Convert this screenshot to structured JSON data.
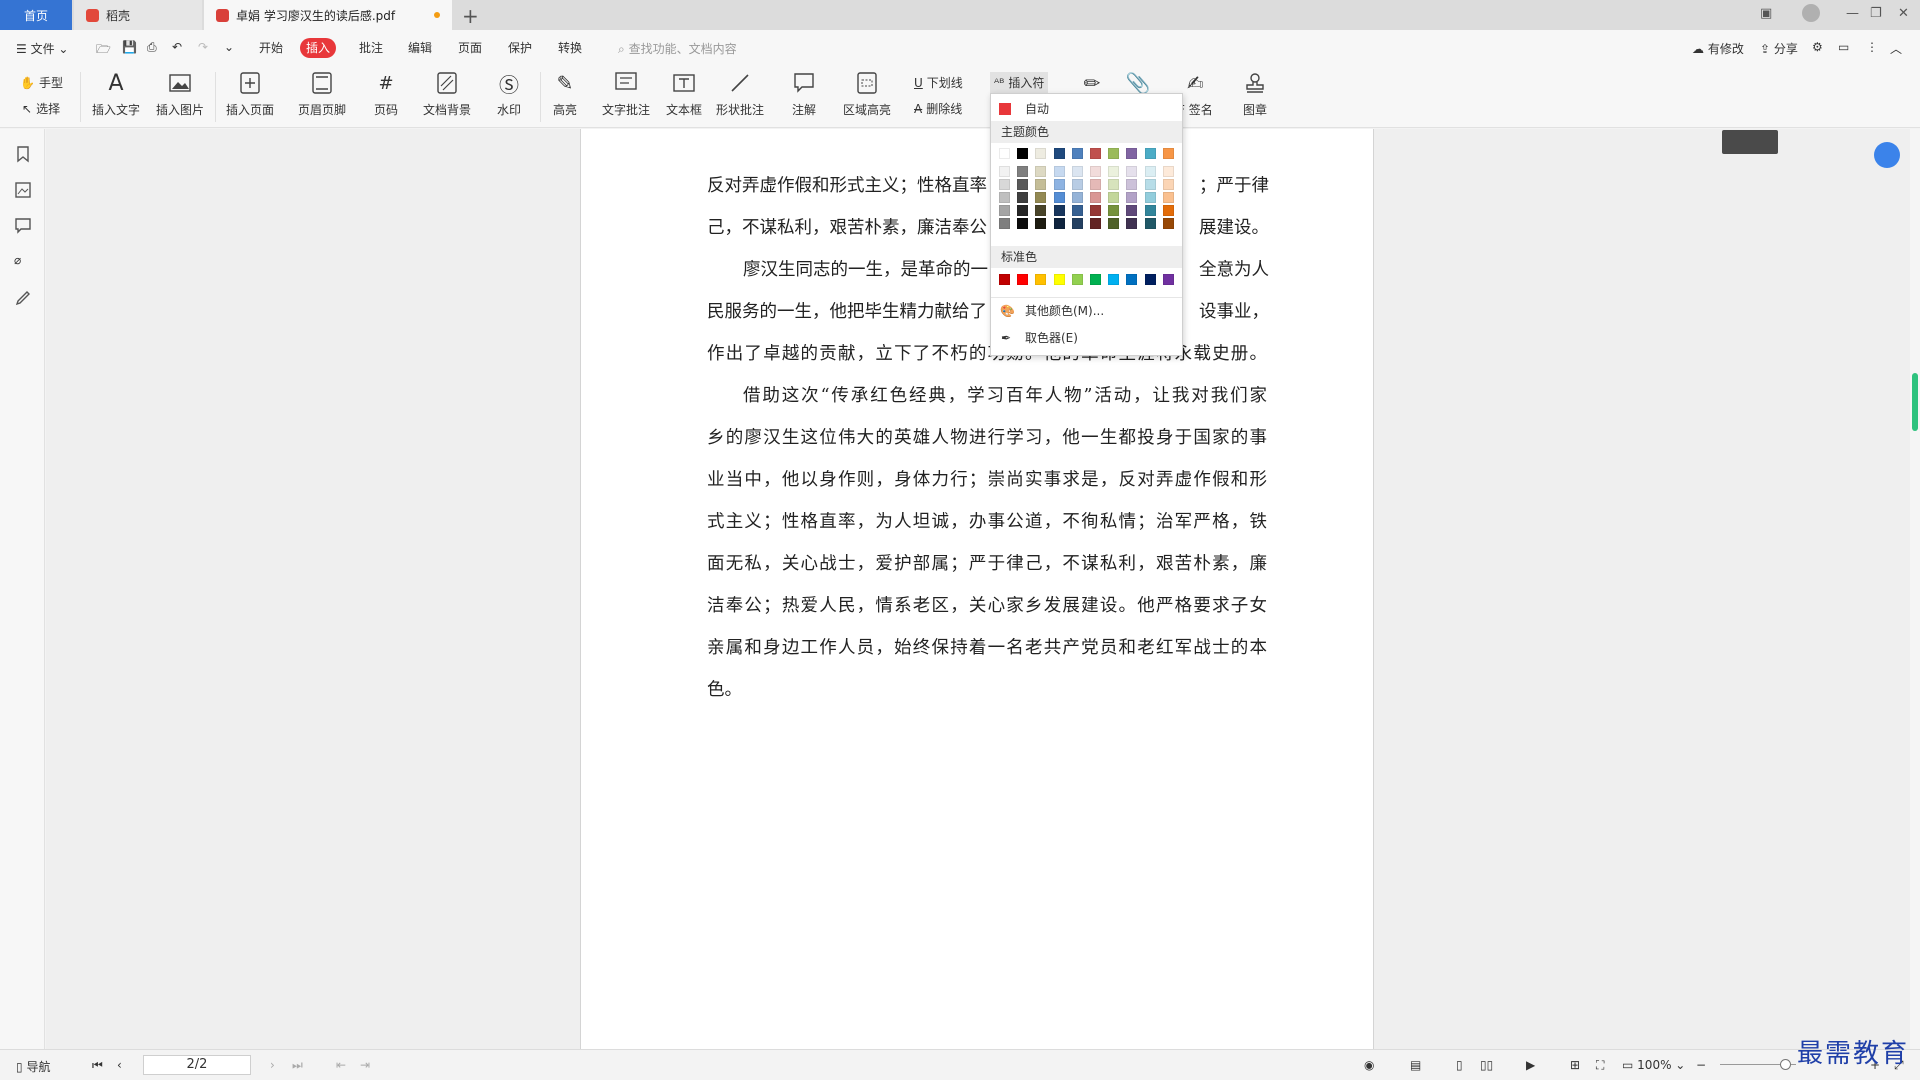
{
  "tabs": {
    "home": "首页",
    "docer": "稻壳",
    "document": "卓娟 学习廖汉生的读后感.pdf"
  },
  "command_bar": {
    "file": "文件",
    "menu_tabs": [
      "开始",
      "插入",
      "批注",
      "编辑",
      "页面",
      "保护",
      "转换"
    ],
    "active_tab": "插入",
    "search_placeholder": "查找功能、文档内容",
    "has_changes": "有修改",
    "share": "分享"
  },
  "ribbon": {
    "hand": "手型",
    "select": "选择",
    "insert_text": "插入文字",
    "insert_image": "插入图片",
    "insert_page": "插入页面",
    "header_footer": "页眉页脚",
    "page_number": "页码",
    "doc_background": "文档背景",
    "watermark": "水印",
    "highlight": "高亮",
    "text_comment": "文字批注",
    "text_box": "文本框",
    "shape_comment": "形状批注",
    "annotation": "注解",
    "area_highlight": "区域高亮",
    "underline": "下划线",
    "strikethrough": "删除线",
    "insert_symbol": "插入符",
    "sign": "F 签名",
    "stamp": "图章"
  },
  "color_dropdown": {
    "auto": "自动",
    "theme_colors": "主题颜色",
    "standard_colors": "标准色",
    "more_colors": "其他颜色(M)...",
    "eyedropper": "取色器(E)",
    "auto_color": "#e8373a",
    "theme_top": [
      "#ffffff",
      "#000000",
      "#eeece1",
      "#1f497d",
      "#4f81bd",
      "#c0504d",
      "#9bbb59",
      "#8064a2",
      "#4bacc6",
      "#f79646"
    ],
    "theme_shades": [
      [
        "#f2f2f2",
        "#7f7f7f",
        "#ddd9c3",
        "#c6d9f0",
        "#dbe5f1",
        "#f2dcdb",
        "#ebf1dd",
        "#e5e0ec",
        "#dbeef3",
        "#fdeada"
      ],
      [
        "#d8d8d8",
        "#595959",
        "#c4bd97",
        "#8db3e2",
        "#b8cce4",
        "#e5b9b7",
        "#d7e3bc",
        "#ccc1d9",
        "#b7dde8",
        "#fbd5b5"
      ],
      [
        "#bfbfbf",
        "#3f3f3f",
        "#938953",
        "#548dd4",
        "#95b3d7",
        "#d99694",
        "#c3d69b",
        "#b2a2c7",
        "#92cddc",
        "#fac08f"
      ],
      [
        "#a5a5a5",
        "#262626",
        "#494429",
        "#17365d",
        "#366092",
        "#953734",
        "#76923c",
        "#5f497a",
        "#31859b",
        "#e36c09"
      ],
      [
        "#7f7f7f",
        "#0c0c0c",
        "#1d1b10",
        "#0f243e",
        "#244061",
        "#632423",
        "#4f6128",
        "#3f3151",
        "#205867",
        "#974806"
      ]
    ],
    "standard": [
      "#c00000",
      "#ff0000",
      "#ffc000",
      "#ffff00",
      "#92d050",
      "#00b050",
      "#00b0f0",
      "#0070c0",
      "#002060",
      "#7030a0"
    ]
  },
  "document": {
    "lines": [
      "反对弄虚作假和形式主义；性格直率",
      "；严于律",
      "己，不谋私利，艰苦朴素，廉洁奉公",
      "展建设。",
      "廖汉生同志的一生，是革命的一",
      "全意为人",
      "民服务的一生，他把毕生精力献给了",
      "设事业，",
      "作出了卓越的贡献，立下了不朽的功勋。他的革命生涯将永载史册。",
      "借助这次“传承红色经典，学习百年人物”活动，让我对我们家",
      "乡的廖汉生这位伟大的英雄人物进行学习，他一生都投身于国家的事",
      "业当中，他以身作则，身体力行；崇尚实事求是，反对弄虚作假和形",
      "式主义；性格直率，为人坦诚，办事公道，不徇私情；治军严格，铁",
      "面无私，关心战士，爱护部属；严于律己，不谋私利，艰苦朴素，廉",
      "洁奉公；热爱人民，情系老区，关心家乡发展建设。他严格要求子女",
      "亲属和身边工作人员，始终保持着一名老共产党员和老红军战士的本",
      "色。"
    ]
  },
  "statusbar": {
    "nav": "导航",
    "page": "2/2",
    "zoom": "100%"
  },
  "watermark": "最需教育"
}
